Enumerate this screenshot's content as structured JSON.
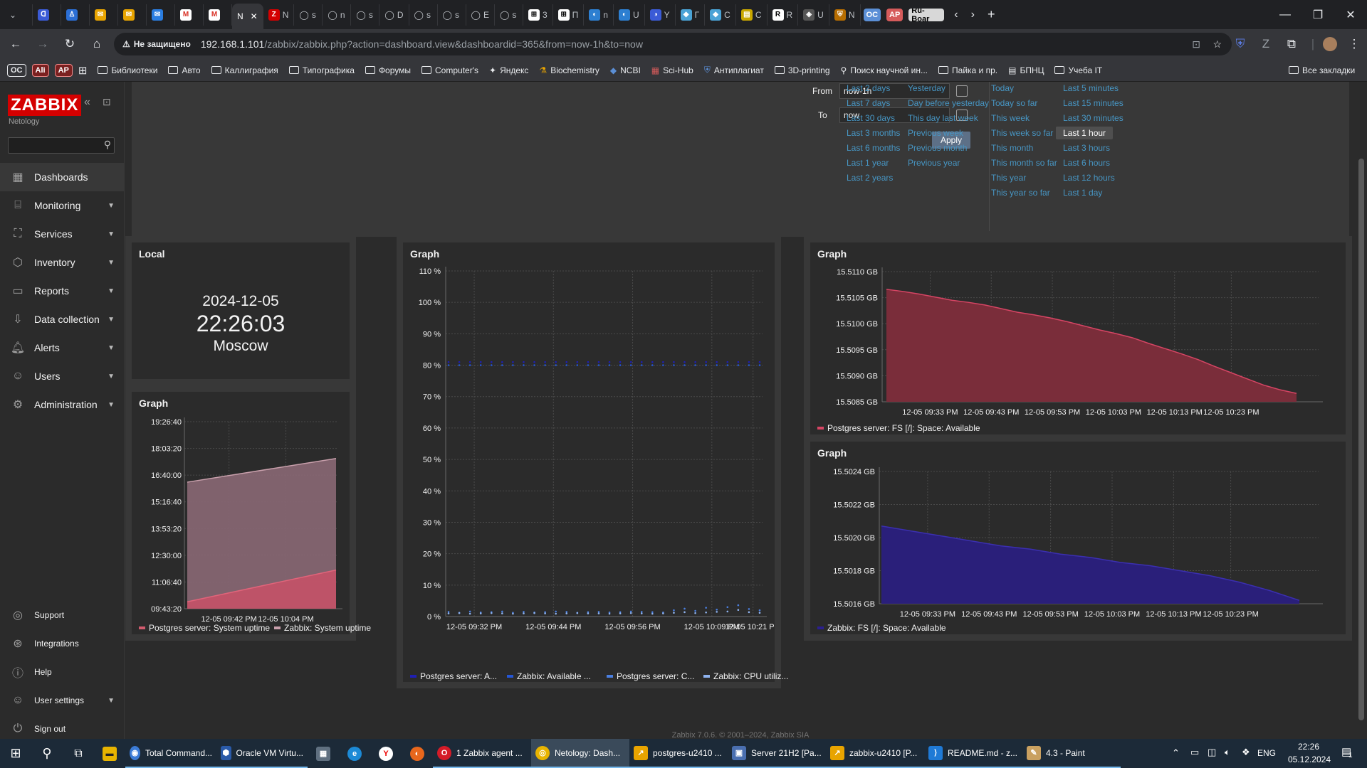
{
  "browser": {
    "tabs": [
      {
        "icon": "chevron-down-icon",
        "label": ""
      },
      {
        "icon": "tab-icon",
        "label": ""
      },
      {
        "icon": "tab-icon",
        "label": ""
      },
      {
        "icon": "gmail-icon",
        "label": ""
      },
      {
        "icon": "gmail-icon",
        "label": ""
      },
      {
        "icon": "tab-icon",
        "label": ""
      },
      {
        "icon": "gmail-icon",
        "label": ""
      },
      {
        "icon": "gmail-icon",
        "label": ""
      },
      {
        "icon": "tab-icon",
        "label": "N"
      },
      {
        "icon": "zabbix-icon",
        "label": "N"
      },
      {
        "icon": "github-icon",
        "label": "s"
      },
      {
        "icon": "github-icon",
        "label": "n"
      },
      {
        "icon": "github-icon",
        "label": "s"
      },
      {
        "icon": "github-icon",
        "label": "D"
      },
      {
        "icon": "github-icon",
        "label": "s"
      },
      {
        "icon": "github-icon",
        "label": "s"
      },
      {
        "icon": "github-icon",
        "label": "E"
      },
      {
        "icon": "github-icon",
        "label": "s"
      },
      {
        "icon": "tab-icon",
        "label": "3"
      },
      {
        "icon": "tab-icon",
        "label": "П"
      },
      {
        "icon": "tab-icon",
        "label": "n"
      },
      {
        "icon": "tab-icon",
        "label": "U"
      },
      {
        "icon": "tab-icon",
        "label": "Y"
      },
      {
        "icon": "tab-icon",
        "label": "Г"
      },
      {
        "icon": "tab-icon",
        "label": "C"
      },
      {
        "icon": "tab-icon",
        "label": "C"
      },
      {
        "icon": "tab-icon",
        "label": "R"
      },
      {
        "icon": "tab-icon",
        "label": "U"
      },
      {
        "icon": "tab-icon",
        "label": "N"
      }
    ],
    "tab_groups": [
      "OC",
      "AP",
      "Ru-Boar"
    ],
    "not_secure": "Не защищено",
    "url_host": "192.168.1.101",
    "url_path": "/zabbix/zabbix.php?action=dashboard.view&dashboardid=365&from=now-1h&to=now",
    "bookmarks": [
      {
        "icon": "badge",
        "label": "OC"
      },
      {
        "icon": "badge",
        "label": "Ali"
      },
      {
        "icon": "badge",
        "label": "AP"
      },
      {
        "icon": "apps-icon",
        "label": ""
      },
      {
        "icon": "folder-icon",
        "label": "Библиотеки"
      },
      {
        "icon": "folder-icon",
        "label": "Авто"
      },
      {
        "icon": "folder-icon",
        "label": "Каллиграфия"
      },
      {
        "icon": "folder-icon",
        "label": "Типографика"
      },
      {
        "icon": "folder-icon",
        "label": "Форумы"
      },
      {
        "icon": "folder-icon",
        "label": "Computer's"
      },
      {
        "icon": "star-icon",
        "label": "Яндекс"
      },
      {
        "icon": "link-icon",
        "label": "Biochemistry"
      },
      {
        "icon": "link-icon",
        "label": "NCBI"
      },
      {
        "icon": "link-icon",
        "label": "Sci-Hub"
      },
      {
        "icon": "shield-icon",
        "label": "Антиплагиат"
      },
      {
        "icon": "folder-icon",
        "label": "3D-printing"
      },
      {
        "icon": "link-icon",
        "label": "Поиск научной ин..."
      },
      {
        "icon": "folder-icon",
        "label": "Пайка и пр."
      },
      {
        "icon": "link-icon",
        "label": "БПНЦ"
      },
      {
        "icon": "folder-icon",
        "label": "Учеба IT"
      }
    ],
    "all_bookmarks": "Все закладки"
  },
  "sidebar": {
    "logo": "ZABBIX",
    "instance": "Netology",
    "items": [
      {
        "icon": "dashboard-icon",
        "label": "Dashboards",
        "selected": true,
        "chevron": false
      },
      {
        "icon": "monitoring-icon",
        "label": "Monitoring",
        "chevron": true
      },
      {
        "icon": "services-icon",
        "label": "Services",
        "chevron": true
      },
      {
        "icon": "inventory-icon",
        "label": "Inventory",
        "chevron": true
      },
      {
        "icon": "reports-icon",
        "label": "Reports",
        "chevron": true
      },
      {
        "icon": "data-collection-icon",
        "label": "Data collection",
        "chevron": true
      },
      {
        "icon": "alerts-icon",
        "label": "Alerts",
        "chevron": true
      },
      {
        "icon": "users-icon",
        "label": "Users",
        "chevron": true
      },
      {
        "icon": "administration-icon",
        "label": "Administration",
        "chevron": true
      }
    ],
    "bottom_items": [
      {
        "icon": "support-icon",
        "label": "Support"
      },
      {
        "icon": "integrations-icon",
        "label": "Integrations"
      },
      {
        "icon": "help-icon",
        "label": "Help"
      },
      {
        "icon": "user-icon",
        "label": "User settings"
      },
      {
        "icon": "sign-out-icon",
        "label": "Sign out"
      }
    ]
  },
  "time_filter": {
    "from_label": "From",
    "from_value": "now-1h",
    "to_label": "To",
    "to_value": "now",
    "apply": "Apply",
    "quick": [
      [
        "Last 2 days",
        "Last 7 days",
        "Last 30 days",
        "Last 3 months",
        "Last 6 months",
        "Last 1 year",
        "Last 2 years"
      ],
      [
        "Yesterday",
        "Day before yesterday",
        "This day last week",
        "Previous week",
        "Previous month",
        "Previous year"
      ],
      [
        "Today",
        "Today so far",
        "This week",
        "This week so far",
        "This month",
        "This month so far",
        "This year",
        "This year so far"
      ],
      [
        "Last 5 minutes",
        "Last 15 minutes",
        "Last 30 minutes",
        "Last 1 hour",
        "Last 3 hours",
        "Last 6 hours",
        "Last 12 hours",
        "Last 1 day"
      ]
    ],
    "selected": "Last 1 hour"
  },
  "clock": {
    "title": "Local",
    "date": "2024-12-05",
    "time": "22:26:03",
    "tz": "Moscow"
  },
  "graphs": {
    "uptime": {
      "title": "Graph",
      "legend": [
        "Postgres server: System uptime",
        "Zabbix: System uptime"
      ]
    },
    "cpu": {
      "title": "Graph",
      "legend": [
        "Postgres server: A...",
        "Zabbix: Available ...",
        "Postgres server: C...",
        "Zabbix: CPU utiliz..."
      ]
    },
    "fs_pg": {
      "title": "Graph",
      "legend": [
        "Postgres server: FS [/]: Space: Available"
      ]
    },
    "fs_zbx": {
      "title": "Graph",
      "legend": [
        "Zabbix: FS [/]: Space: Available"
      ]
    }
  },
  "chart_data": [
    {
      "type": "area",
      "title": "Graph",
      "ylabels": [
        "19:26:40",
        "18:03:20",
        "16:40:00",
        "15:16:40",
        "13:53:20",
        "12:30:00",
        "11:06:40",
        "09:43:20"
      ],
      "xlabels": [
        "12-05 09:42 PM",
        "12-05 10:04 PM"
      ],
      "series": [
        {
          "name": "Postgres server: System uptime",
          "color": "#d15b6e",
          "start": "10:05",
          "end": "11:44"
        },
        {
          "name": "Zabbix: System uptime",
          "color": "#9c6b78",
          "start": "16:18",
          "end": "17:32"
        }
      ]
    },
    {
      "type": "line",
      "title": "Graph",
      "ylabels": [
        "110 %",
        "100 %",
        "90 %",
        "80 %",
        "70 %",
        "60 %",
        "50 %",
        "40 %",
        "30 %",
        "20 %",
        "10 %",
        "0 %"
      ],
      "xlabels": [
        "12-05 09:32 PM",
        "12-05 09:44 PM",
        "12-05 09:56 PM",
        "12-05 10:09 PM",
        "12-05 10:21 PM"
      ],
      "series": [
        {
          "name": "Postgres server: A...",
          "color": "#1f1fb4",
          "values_percent": [
            81,
            81,
            81,
            81,
            81,
            81,
            81,
            81,
            81,
            81,
            81,
            81,
            81,
            81,
            81,
            81,
            81,
            81,
            81,
            81,
            81,
            81,
            81,
            81,
            81,
            81,
            81,
            81,
            81,
            81
          ]
        },
        {
          "name": "Zabbix: Available ...",
          "color": "#2456d6",
          "values_percent": [
            80,
            80,
            80,
            80,
            80,
            80,
            80,
            80,
            80,
            80,
            80,
            80,
            80,
            80,
            80,
            80,
            80,
            80,
            80,
            80,
            80,
            80,
            80,
            80,
            80,
            80,
            80,
            80,
            80,
            80
          ]
        },
        {
          "name": "Postgres server: C...",
          "color": "#4a7fe0",
          "values_percent": [
            1.5,
            1.2,
            1.6,
            1.3,
            1.4,
            1.6,
            1.2,
            1.5,
            1.3,
            1.4,
            1.6,
            1.5,
            1.2,
            1.4,
            1.5,
            1.3,
            1.4,
            1.6,
            1.5,
            1.4,
            1.3,
            2.0,
            2.5,
            1.8,
            2.8,
            2.2,
            3.0,
            3.6,
            2.4,
            2.0
          ]
        },
        {
          "name": "Zabbix: CPU utiliz...",
          "color": "#8fb3ef",
          "values_percent": [
            1.0,
            1.1,
            0.9,
            1.0,
            1.1,
            1.0,
            0.9,
            1.0,
            1.1,
            1.0,
            0.9,
            1.0,
            1.1,
            1.0,
            1.0,
            0.9,
            1.0,
            1.1,
            1.0,
            0.9,
            1.0,
            1.2,
            1.4,
            1.1,
            1.3,
            1.5,
            1.6,
            2.1,
            1.4,
            1.2
          ]
        }
      ]
    },
    {
      "type": "area",
      "title": "Graph",
      "ylabels": [
        "15.5110 GB",
        "15.5105 GB",
        "15.5100 GB",
        "15.5095 GB",
        "15.5090 GB",
        "15.5085 GB"
      ],
      "xlabels": [
        "12-05 09:33 PM",
        "12-05 09:43 PM",
        "12-05 09:53 PM",
        "12-05 10:03 PM",
        "12-05 10:13 PM",
        "12-05 10:23 PM"
      ],
      "series": [
        {
          "name": "Postgres server: FS [/]: Space: Available",
          "color": "#d64564",
          "values_gb": [
            15.51066,
            15.51062,
            15.51057,
            15.51051,
            15.51045,
            15.51041,
            15.51036,
            15.51029,
            15.51022,
            15.51017,
            15.51011,
            15.51004,
            15.50996,
            15.50988,
            15.50981,
            15.50973,
            15.50962,
            15.50952,
            15.50942,
            15.50931,
            15.50918,
            15.50906,
            15.50894,
            15.50882,
            15.50873,
            15.50866
          ]
        }
      ]
    },
    {
      "type": "area",
      "title": "Graph",
      "ylabels": [
        "15.5024 GB",
        "15.5022 GB",
        "15.5020 GB",
        "15.5018 GB",
        "15.5016 GB"
      ],
      "xlabels": [
        "12-05 09:33 PM",
        "12-05 09:43 PM",
        "12-05 09:53 PM",
        "12-05 10:03 PM",
        "12-05 10:13 PM",
        "12-05 10:23 PM"
      ],
      "series": [
        {
          "name": "Zabbix: FS [/]: Space: Available",
          "color": "#2b1f8f",
          "values_gb": [
            15.50207,
            15.50204,
            15.50201,
            15.50198,
            15.50195,
            15.50193,
            15.5019,
            15.50188,
            15.50185,
            15.50183,
            15.5018,
            15.50177,
            15.50173,
            15.50168,
            15.50162
          ]
        }
      ]
    }
  ],
  "footer": "Zabbix 7.0.6. © 2001–2024, Zabbix SIA",
  "taskbar": {
    "items": [
      {
        "icon": "windows-start-icon",
        "label": ""
      },
      {
        "icon": "search-icon",
        "label": ""
      },
      {
        "icon": "task-view-icon",
        "label": ""
      },
      {
        "icon": "file-explorer-icon",
        "label": ""
      },
      {
        "icon": "total-commander-icon",
        "label": "Total Command..."
      },
      {
        "icon": "virtualbox-icon",
        "label": "Oracle VM Virtu..."
      },
      {
        "icon": "calculator-icon",
        "label": ""
      },
      {
        "icon": "edge-icon",
        "label": ""
      },
      {
        "icon": "yandex-icon",
        "label": ""
      },
      {
        "icon": "firefox-icon",
        "label": ""
      },
      {
        "icon": "opera-icon",
        "label": "1 Zabbix agent ..."
      },
      {
        "icon": "chrome-icon",
        "label": "Netology: Dash..."
      },
      {
        "icon": "vm-icon",
        "label": "postgres-u2410 ..."
      },
      {
        "icon": "vm-icon",
        "label": "Server 21H2 [Pa..."
      },
      {
        "icon": "vm-icon",
        "label": "zabbix-u2410 [P..."
      },
      {
        "icon": "vscode-icon",
        "label": "README.md - z..."
      },
      {
        "icon": "paint-icon",
        "label": "4.3 - Paint"
      }
    ],
    "lang": "ENG",
    "time": "22:26",
    "date": "05.12.2024",
    "notifications": "1"
  }
}
